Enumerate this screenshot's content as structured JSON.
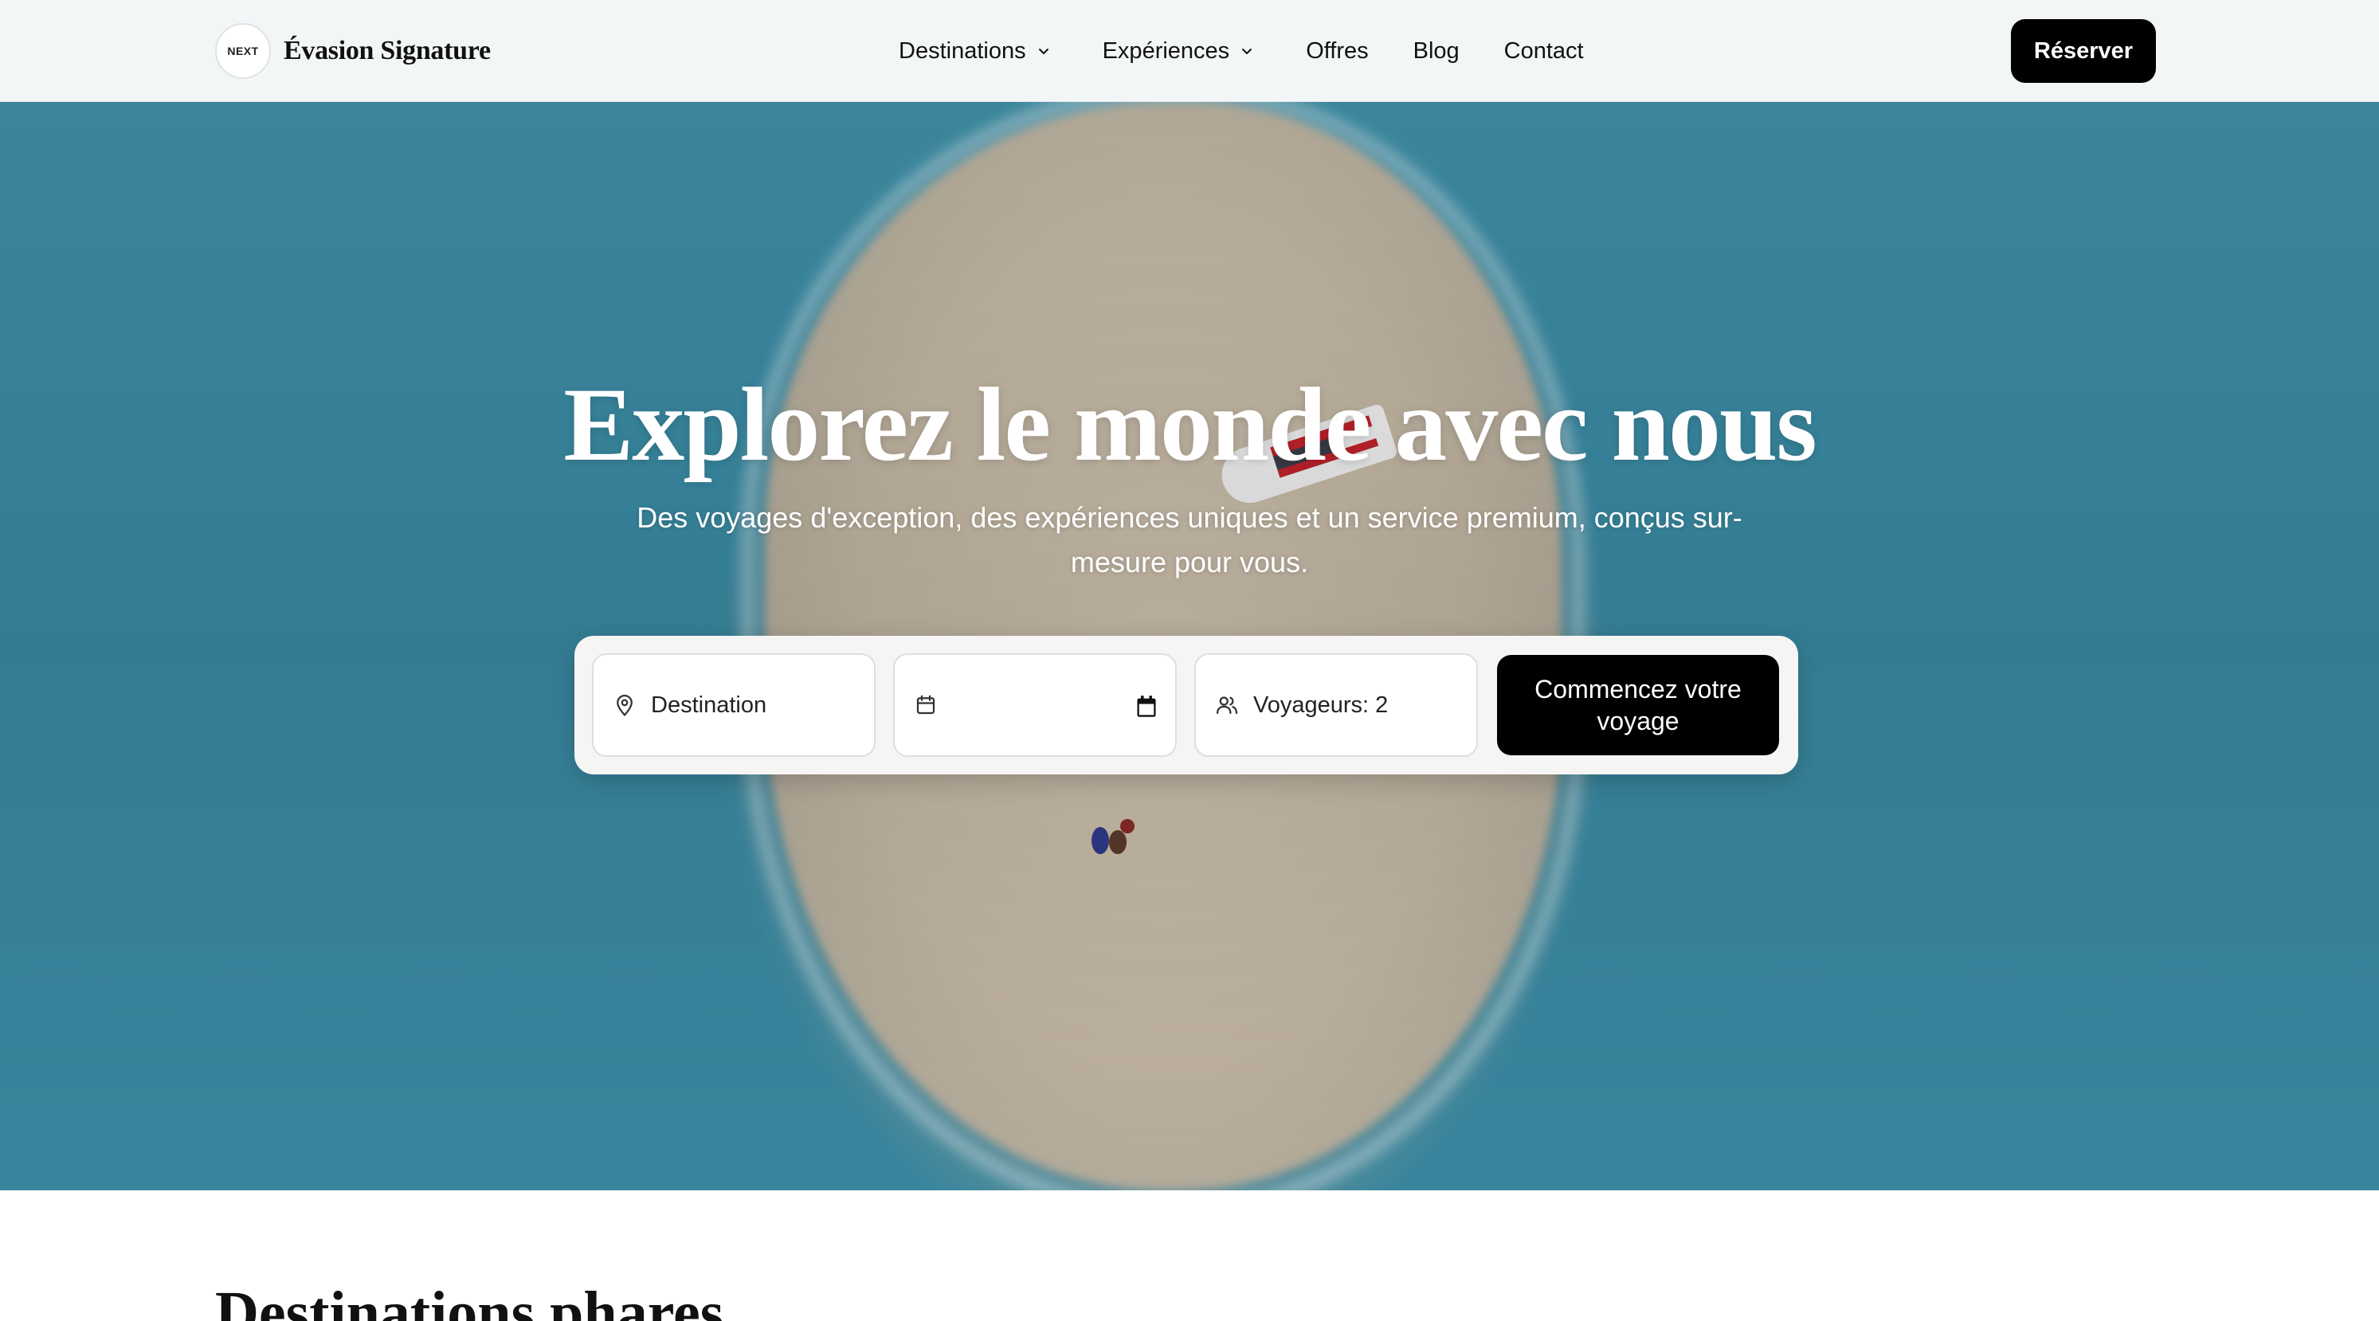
{
  "header": {
    "logo_badge": "NEXT",
    "brand_name": "Évasion Signature",
    "nav": [
      {
        "label": "Destinations",
        "dropdown": true
      },
      {
        "label": "Expériences",
        "dropdown": true
      },
      {
        "label": "Offres",
        "dropdown": false
      },
      {
        "label": "Blog",
        "dropdown": false
      },
      {
        "label": "Contact",
        "dropdown": false
      }
    ],
    "cta_label": "Réserver"
  },
  "hero": {
    "title": "Explorez le monde avec nous",
    "subtitle": "Des voyages d'exception, des expériences uniques et un service premium, conçus sur-mesure pour vous."
  },
  "search": {
    "destination_placeholder": "Destination",
    "date_value": "",
    "travelers_label": "Voyageurs: 2",
    "submit_label": "Commencez votre voyage",
    "icons": [
      "map-pin-icon",
      "calendar-icon",
      "users-icon"
    ]
  },
  "section": {
    "title": "Destinations phares"
  },
  "colors": {
    "primary": "#000000",
    "header_bg": "#f3f6f7",
    "ocean": "#3b8ea8",
    "sand": "#c9bba7"
  }
}
